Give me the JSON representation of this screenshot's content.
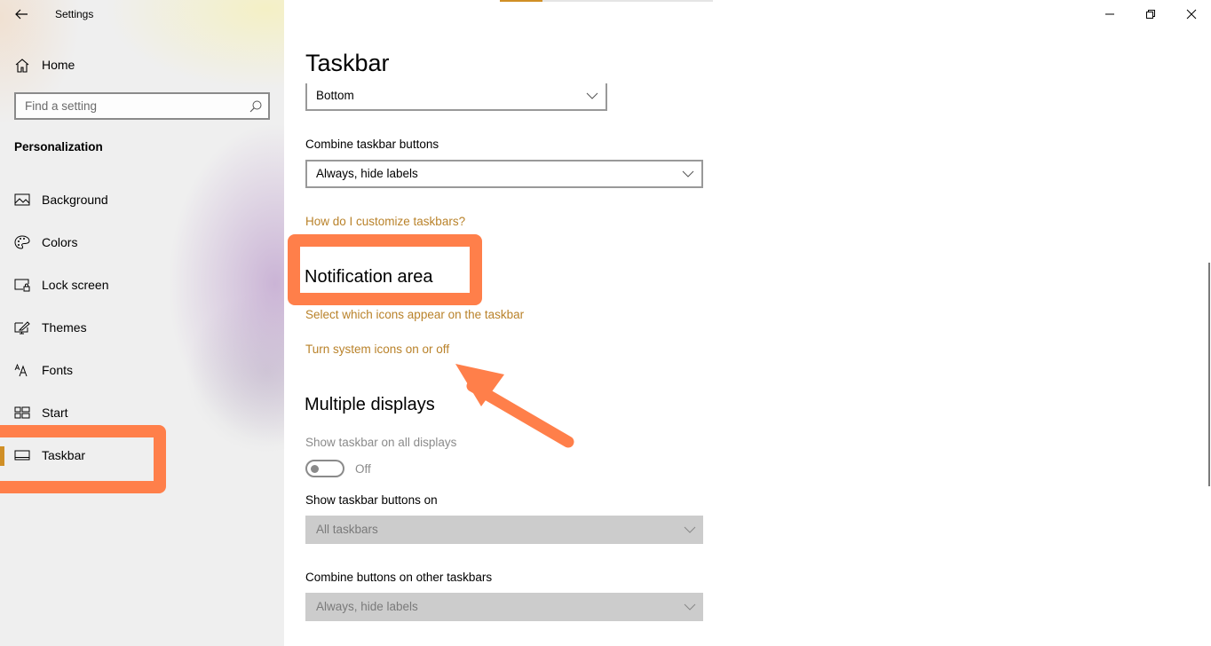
{
  "window": {
    "title": "Settings",
    "controls": {
      "minimize": "minimize-icon",
      "restore": "restore-icon",
      "close": "close-icon"
    }
  },
  "sidebar": {
    "back_icon": "back-arrow-icon",
    "home": {
      "label": "Home",
      "icon": "home-icon"
    },
    "search": {
      "placeholder": "Find a setting",
      "value": "",
      "icon": "search-icon"
    },
    "section_heading": "Personalization",
    "items": [
      {
        "label": "Background",
        "icon": "image-icon",
        "active": false
      },
      {
        "label": "Colors",
        "icon": "palette-icon",
        "active": false
      },
      {
        "label": "Lock screen",
        "icon": "lock-screen-icon",
        "active": false
      },
      {
        "label": "Themes",
        "icon": "themes-icon",
        "active": false
      },
      {
        "label": "Fonts",
        "icon": "fonts-icon",
        "active": false
      },
      {
        "label": "Start",
        "icon": "start-icon",
        "active": false
      },
      {
        "label": "Taskbar",
        "icon": "taskbar-icon",
        "active": true
      }
    ]
  },
  "main": {
    "page_title": "Taskbar",
    "top_progress_fraction": 0.2,
    "taskbar_location": {
      "value": "Bottom"
    },
    "combine_buttons": {
      "label": "Combine taskbar buttons",
      "value": "Always, hide labels"
    },
    "customize_link": "How do I customize taskbars?",
    "notification_area": {
      "heading": "Notification area",
      "links": [
        "Select which icons appear on the taskbar",
        "Turn system icons on or off"
      ]
    },
    "multiple_displays": {
      "heading": "Multiple displays",
      "show_on_all": {
        "label": "Show taskbar on all displays",
        "state": "Off",
        "enabled": false
      },
      "show_buttons_on": {
        "label": "Show taskbar buttons on",
        "value": "All taskbars",
        "enabled": false
      },
      "combine_other": {
        "label": "Combine buttons on other taskbars",
        "value": "Always, hide labels",
        "enabled": false
      }
    }
  },
  "colors": {
    "accent": "#d08f26",
    "link": "#b9822a",
    "annotation": "#ff7f4a",
    "disabled_fill": "#cccccc"
  }
}
